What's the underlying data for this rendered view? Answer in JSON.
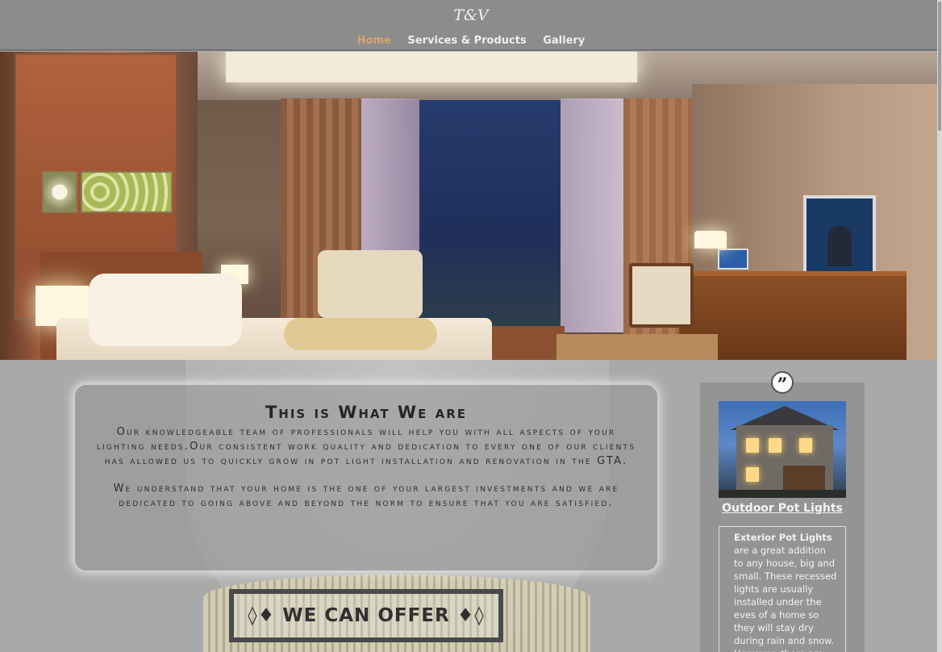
{
  "header": {
    "logo": "T&V",
    "nav": [
      {
        "label": "Home",
        "active": true
      },
      {
        "label": "Services & Products",
        "active": false
      },
      {
        "label": "Gallery",
        "active": false
      }
    ]
  },
  "colors": {
    "header_bg": "#8c8c8c",
    "nav_active": "#d9a46a",
    "page_bg": "#a9a9a9"
  },
  "about": {
    "title": "This is What We are",
    "paragraph1": "Our knowledgeable team of professionals will help you with all aspects of your lighting needs.Our consistent work quality and dedication to every one of our clients has allowed us to quickly grow in pot light installation and renovation in the GTA.",
    "paragraph2": "We understand that your home is the one of your largest investments and we are dedicated to going above and beyond the norm to ensure that you are satisfied."
  },
  "offer": {
    "label": "◊♦ WE CAN OFFER ♦◊"
  },
  "sidebar": {
    "quote_icon": "quote-icon",
    "title": "Outdoor Pot Lights",
    "card_bold": "Exterior Pot Lights",
    "card_text": " are a great addition to any house, big and small. These recessed lights are usually installed under the eves of a home so they will stay dry during rain and snow. However, there are exterior pot lights"
  }
}
